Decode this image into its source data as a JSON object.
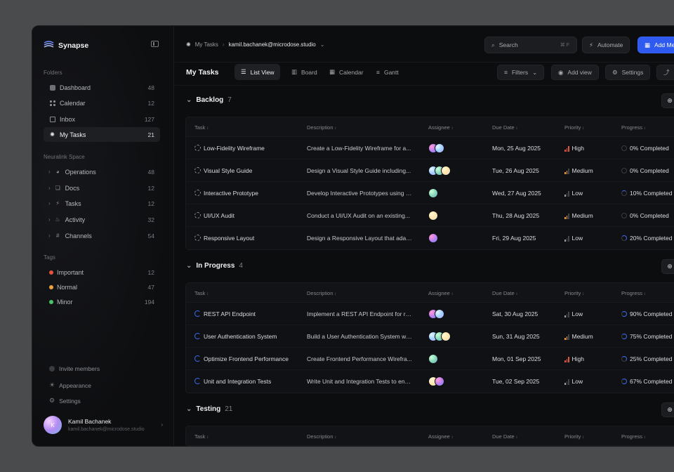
{
  "app": {
    "name": "Synapse"
  },
  "sidebar": {
    "folders_title": "Folders",
    "folders": [
      {
        "label": "Dashboard",
        "count": "48",
        "icon": "dashboard-icon"
      },
      {
        "label": "Calendar",
        "count": "12",
        "icon": "calendar-icon"
      },
      {
        "label": "Inbox",
        "count": "127",
        "icon": "inbox-icon"
      },
      {
        "label": "My Tasks",
        "count": "21",
        "icon": "bulb-icon",
        "active": true
      }
    ],
    "space_title": "Neuralink Space",
    "space": [
      {
        "label": "Operations",
        "count": "48",
        "icon": "pie-icon"
      },
      {
        "label": "Docs",
        "count": "12",
        "icon": "docs-icon"
      },
      {
        "label": "Tasks",
        "count": "12",
        "icon": "bolt-icon"
      },
      {
        "label": "Activity",
        "count": "32",
        "icon": "flame-icon"
      },
      {
        "label": "Channels",
        "count": "54",
        "icon": "hash-icon"
      }
    ],
    "tags_title": "Tags",
    "tags": [
      {
        "label": "Important",
        "count": "12",
        "color": "#e5533d"
      },
      {
        "label": "Normal",
        "count": "47",
        "color": "#f0a23a"
      },
      {
        "label": "Minor",
        "count": "194",
        "color": "#4cc36a"
      }
    ],
    "bottom": [
      {
        "label": "Invite members",
        "icon": "invite-icon"
      },
      {
        "label": "Appearance",
        "icon": "sun-icon"
      },
      {
        "label": "Settings",
        "icon": "gear-icon"
      }
    ],
    "user": {
      "name": "Kamil Bachanek",
      "email": "kamil.bachanek@microdose.studio",
      "initial": "K"
    }
  },
  "header": {
    "crumb_root": "My Tasks",
    "crumb_account": "kamil.bachanek@microdose.studio",
    "search_label": "Search",
    "search_shortcut": "⌘ F",
    "automate_label": "Automate",
    "add_label": "Add Me"
  },
  "toolbar": {
    "title": "My Tasks",
    "views": [
      "List View",
      "Board",
      "Calendar",
      "Gantt"
    ],
    "filters_label": "Filters",
    "add_view_label": "Add view",
    "settings_label": "Settings",
    "share_label": "S"
  },
  "columns": [
    "Task",
    "Description",
    "Assignee",
    "Due Date",
    "Priority",
    "Progress"
  ],
  "groups": [
    {
      "name": "Backlog",
      "count": "7",
      "rows": [
        {
          "task": "Low-Fidelity Wireframe",
          "description": "Create a Low-Fidelity Wireframe for a...",
          "due": "Mon, 25 Aug 2025",
          "priority": "High",
          "progress": "0% Completed",
          "progress_value": 0,
          "assignees": 2
        },
        {
          "task": "Visual Style Guide",
          "description": "Design a Visual Style Guide including...",
          "due": "Tue, 26 Aug 2025",
          "priority": "Medium",
          "progress": "0% Completed",
          "progress_value": 0,
          "assignees": 3
        },
        {
          "task": "Interactive Prototype",
          "description": "Develop Interactive Prototypes using t...",
          "due": "Wed, 27 Aug 2025",
          "priority": "Low",
          "progress": "10% Completed",
          "progress_value": 10,
          "assignees": 1
        },
        {
          "task": "UI/UX Audit",
          "description": "Conduct a UI/UX Audit on an existing...",
          "due": "Thu, 28 Aug 2025",
          "priority": "Medium",
          "progress": "0% Completed",
          "progress_value": 0,
          "assignees": 1
        },
        {
          "task": "Responsive Layout",
          "description": "Design a Responsive Layout that adap...",
          "due": "Fri, 29 Aug 2025",
          "priority": "Low",
          "progress": "20% Completed",
          "progress_value": 20,
          "assignees": 1
        }
      ]
    },
    {
      "name": "In Progress",
      "count": "4",
      "rows": [
        {
          "task": "REST API Endpoint",
          "description": "Implement a REST API Endpoint for re...",
          "due": "Sat, 30 Aug 2025",
          "priority": "Low",
          "progress": "90% Completed",
          "progress_value": 90,
          "assignees": 2
        },
        {
          "task": "User Authentication System",
          "description": "Build a User Authentication System wi...",
          "due": "Sun, 31 Aug 2025",
          "priority": "Medium",
          "progress": "75% Completed",
          "progress_value": 75,
          "assignees": 3
        },
        {
          "task": "Optimize Frontend Performance",
          "description": "Create Frontend Performance Wirefra...",
          "due": "Mon, 01 Sep 2025",
          "priority": "High",
          "progress": "25% Completed",
          "progress_value": 25,
          "assignees": 1
        },
        {
          "task": "Unit and Integration Tests",
          "description": "Write Unit and Integration Tests to ens...",
          "due": "Tue, 02 Sep 2025",
          "priority": "Low",
          "progress": "67% Completed",
          "progress_value": 67,
          "assignees": 2
        }
      ]
    },
    {
      "name": "Testing",
      "count": "21",
      "rows": []
    }
  ]
}
